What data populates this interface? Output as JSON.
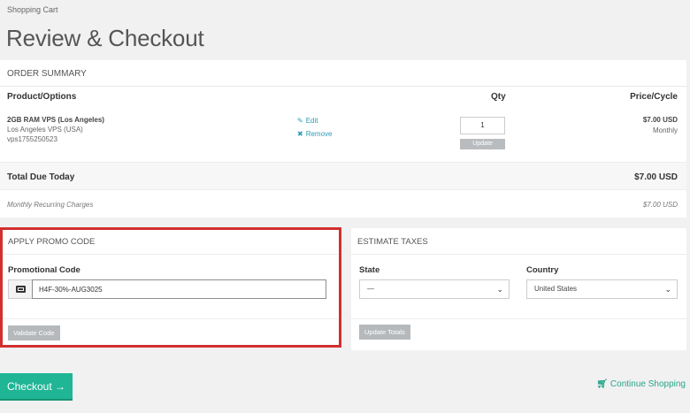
{
  "breadcrumb": "Shopping Cart",
  "page_title": "Review & Checkout",
  "order_summary": {
    "header": "ORDER SUMMARY",
    "col_product": "Product/Options",
    "col_qty": "Qty",
    "col_price": "Price/Cycle",
    "item": {
      "name": "2GB RAM VPS (Los Angeles)",
      "group": "Los Angeles VPS (USA)",
      "hostname": "vps1755250523",
      "edit_label": "Edit",
      "remove_label": "Remove",
      "qty": "1",
      "update_label": "Update",
      "price": "$7.00 USD",
      "cycle": "Monthly"
    },
    "total_label": "Total Due Today",
    "total_value": "$7.00 USD",
    "recurring_label": "Monthly Recurring Charges",
    "recurring_value": "$7.00 USD"
  },
  "promo": {
    "header": "APPLY PROMO CODE",
    "field_label": "Promotional Code",
    "value": "H4F-30%-AUG3025",
    "validate_label": "Validate Code"
  },
  "taxes": {
    "header": "ESTIMATE TAXES",
    "state_label": "State",
    "state_value": "—",
    "country_label": "Country",
    "country_value": "United States",
    "update_label": "Update Totals"
  },
  "checkout_label": "Checkout",
  "continue_label": "Continue Shopping",
  "colors": {
    "accent": "#1fb595",
    "link": "#2a9db8",
    "highlight": "#d32f2f"
  },
  "icons": {
    "edit": "pencil-icon",
    "remove": "close-icon",
    "promo": "ticket-icon",
    "checkout": "arrow-right-icon",
    "continue": "cart-icon"
  }
}
